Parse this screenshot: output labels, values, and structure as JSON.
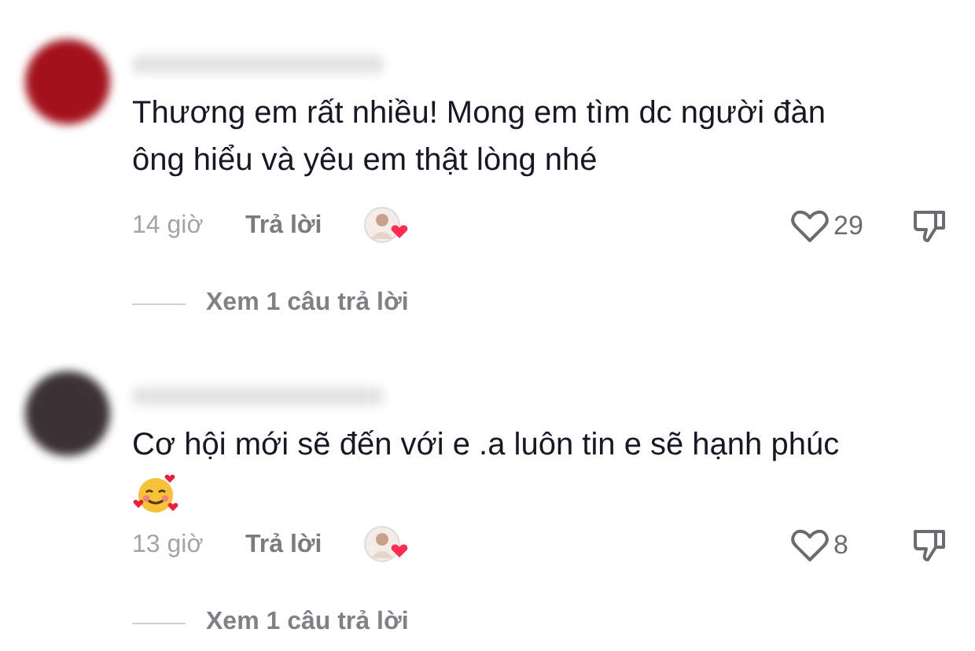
{
  "comments": [
    {
      "avatar": {
        "color": "#a3111c"
      },
      "text": "Thương em rất nhiều! Mong em tìm dc người đàn ông hiểu và yêu em thật lòng nhé",
      "emoji": false,
      "time": "14 giờ",
      "reply": "Trả lời",
      "creator_liked": true,
      "likes": "29",
      "replies": "Xem 1 câu trả lời"
    },
    {
      "avatar": {
        "color": "#3a3234"
      },
      "text": "Cơ hội mới sẽ đến với e .a luôn tin e sẽ hạnh phúc",
      "emoji": true,
      "time": "13 giờ",
      "reply": "Trả lời",
      "creator_liked": true,
      "likes": "8",
      "replies": "Xem 1 câu trả lời"
    }
  ]
}
